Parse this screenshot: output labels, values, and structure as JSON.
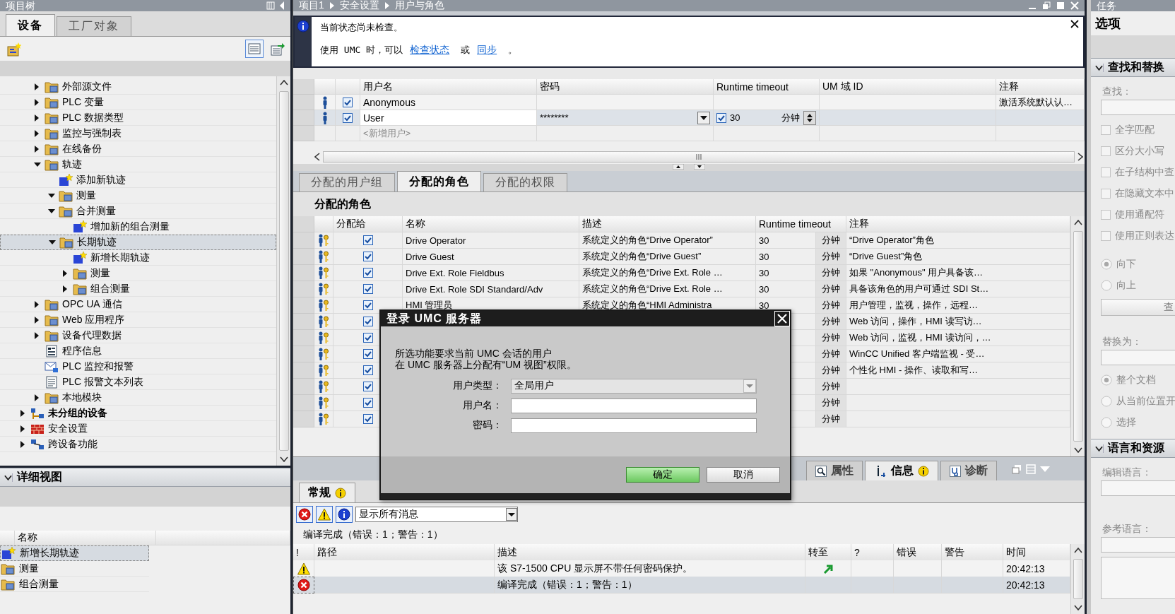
{
  "project_tree": {
    "title": "项目树",
    "tabs": [
      {
        "label": "设备",
        "selected": true
      },
      {
        "label": "工厂对象",
        "selected": false
      }
    ],
    "nested_items": [
      {
        "label": "外部源文件",
        "kind": "folder",
        "expanded": false,
        "selected": false
      },
      {
        "label": "PLC 变量",
        "kind": "folder",
        "expanded": false,
        "selected": false
      },
      {
        "label": "PLC 数据类型",
        "kind": "folder",
        "expanded": false,
        "selected": false
      },
      {
        "label": "监控与强制表",
        "kind": "folder",
        "expanded": false,
        "selected": false
      },
      {
        "label": "在线备份",
        "kind": "folder",
        "expanded": false,
        "selected": false
      },
      {
        "label": "轨迹",
        "kind": "folder",
        "expanded": true,
        "selected": false,
        "children": [
          {
            "label": "添加新轨迹",
            "kind": "add",
            "selected": false
          },
          {
            "label": "测量",
            "kind": "folder",
            "expanded": true,
            "selected": false
          },
          {
            "label": "合并测量",
            "kind": "folder",
            "expanded": true,
            "selected": false,
            "children": [
              {
                "label": "增加新的组合测量",
                "kind": "add",
                "selected": false
              }
            ]
          },
          {
            "label": "长期轨迹",
            "kind": "folder",
            "expanded": true,
            "selected": true,
            "children": [
              {
                "label": "新增长期轨迹",
                "kind": "add",
                "selected": false
              },
              {
                "label": "测量",
                "kind": "folder",
                "expanded": false,
                "selected": false
              },
              {
                "label": "组合测量",
                "kind": "folder",
                "expanded": false,
                "selected": false
              }
            ]
          }
        ]
      },
      {
        "label": "OPC UA 通信",
        "kind": "folder",
        "expanded": false,
        "selected": false
      },
      {
        "label": "Web 应用程序",
        "kind": "folder",
        "expanded": false,
        "selected": false
      },
      {
        "label": "设备代理数据",
        "kind": "folder",
        "expanded": false,
        "selected": false
      },
      {
        "label": "程序信息",
        "kind": "info",
        "selected": false
      },
      {
        "label": "PLC 监控和报警",
        "kind": "alarm",
        "selected": false
      },
      {
        "label": "PLC 报警文本列表",
        "kind": "page",
        "selected": false
      },
      {
        "label": "本地模块",
        "kind": "folder",
        "expanded": false,
        "selected": false
      }
    ],
    "items": [
      {
        "label": "未分组的设备",
        "kind": "devices",
        "expanded": false,
        "selected": false,
        "bold": true
      },
      {
        "label": "安全设置",
        "kind": "security",
        "expanded": false,
        "selected": false
      },
      {
        "label": "跨设备功能",
        "kind": "network",
        "expanded": false,
        "selected": false
      }
    ],
    "detail": {
      "title": "详细视图",
      "columns": [
        "名称"
      ],
      "rows": [
        {
          "label": "新增长期轨迹",
          "kind": "add",
          "selected": true
        },
        {
          "label": "测量",
          "kind": "folder",
          "selected": false
        },
        {
          "label": "组合测量",
          "kind": "folder",
          "selected": false
        }
      ]
    }
  },
  "editor": {
    "breadcrumb": [
      "项目1",
      "安全设置",
      "用户与角色"
    ],
    "banner": {
      "message": "当前状态尚未检查。",
      "prefix": "使用 UMC 时，可以",
      "link_1": "检查状态",
      "middle": "或",
      "link_2": "同步",
      "suffix": "。"
    },
    "users": {
      "columns": [
        "用户名",
        "密码",
        "Runtime timeout",
        "UM 域 ID",
        "注释"
      ],
      "rows": [
        {
          "name": "Anonymous",
          "enabled": true,
          "comment": "激活系统默认认…",
          "selected": false
        },
        {
          "name": "User",
          "enabled": true,
          "password": "********",
          "timeout_enabled": true,
          "timeout": "30",
          "unit": "分钟",
          "selected": true
        }
      ],
      "new_row": "<新增用户>"
    },
    "role_tabs": [
      {
        "label": "分配的用户组",
        "selected": false
      },
      {
        "label": "分配的角色",
        "selected": true
      },
      {
        "label": "分配的权限",
        "selected": false
      }
    ],
    "roles": {
      "title": "分配的角色",
      "columns": [
        "分配给",
        "名称",
        "描述",
        "Runtime timeout",
        "注释"
      ],
      "rows": [
        {
          "assigned": true,
          "name": "Drive Operator",
          "description": "系统定义的角色“Drive Operator”",
          "timeout": "30",
          "unit": "分钟",
          "comment": "“Drive Operator”角色"
        },
        {
          "assigned": true,
          "name": "Drive Guest",
          "description": "系统定义的角色“Drive Guest”",
          "timeout": "30",
          "unit": "分钟",
          "comment": "“Drive Guest”角色"
        },
        {
          "assigned": true,
          "name": "Drive Ext. Role Fieldbus",
          "description": "系统定义的角色“Drive Ext. Role …",
          "timeout": "30",
          "unit": "分钟",
          "comment": "如果 \"Anonymous\" 用户具备该…"
        },
        {
          "assigned": true,
          "name": "Drive Ext. Role SDI Standard/Adv",
          "description": "系统定义的角色“Drive Ext. Role …",
          "timeout": "30",
          "unit": "分钟",
          "comment": "具备该角色的用户可通过 SDI St…"
        },
        {
          "assigned": true,
          "name": "HMI 管理员",
          "description": "系统定义的角色“HMI Administra",
          "timeout": "30",
          "unit": "分钟",
          "comment": "用户管理，监视，操作，远程…"
        },
        {
          "assigned": true,
          "unit": "分钟",
          "comment": "Web 访问，操作，HMI 读写访…"
        },
        {
          "assigned": true,
          "unit": "分钟",
          "comment": "Web 访问，监视，HMI 读访问，…"
        },
        {
          "assigned": true,
          "unit": "分钟",
          "comment": "WinCC Unified 客户端监视 - 受…"
        },
        {
          "assigned": true,
          "unit": "分钟",
          "comment": "个性化 HMI - 操作、读取和写…"
        },
        {
          "assigned": true,
          "unit": "分钟"
        },
        {
          "assigned": true,
          "unit": "分钟"
        },
        {
          "assigned": true,
          "unit": "分钟"
        }
      ]
    },
    "messages": {
      "panel_tabs": [
        {
          "label": "属性",
          "kind": "properties",
          "selected": false
        },
        {
          "label": "信息",
          "kind": "info",
          "selected": true,
          "info_badge": true
        },
        {
          "label": "诊断",
          "kind": "diagnostics",
          "selected": false
        }
      ],
      "tabs": [
        {
          "label": "常规",
          "selected": true,
          "info_badge": true
        }
      ],
      "filters": [
        {
          "kind": "error",
          "on": true
        },
        {
          "kind": "warning",
          "on": true
        },
        {
          "kind": "info",
          "on": true
        }
      ],
      "filter_select": "显示所有消息",
      "summary": "编译完成（错误：1；警告：1）",
      "columns": [
        "!",
        "路径",
        "描述",
        "转至",
        "?",
        "错误",
        "警告",
        "时间"
      ],
      "rows": [
        {
          "kind": "warning",
          "description": "该 S7-1500 CPU 显示屏不带任何密码保护。",
          "goto": true,
          "time": "20:42:13",
          "selected": false
        },
        {
          "kind": "error",
          "description": "编译完成（错误：1；警告：1）",
          "time": "20:42:13",
          "selected": true
        }
      ]
    }
  },
  "tasks": {
    "title": "任务",
    "pane": "选项",
    "find": {
      "title": "查找和替换",
      "expanded": true,
      "find_label": "查找：",
      "options": [
        {
          "label": "全字匹配",
          "checked": false
        },
        {
          "label": "区分大小写",
          "checked": false
        },
        {
          "label": "在子结构中查",
          "checked": false
        },
        {
          "label": "在隐藏文本中",
          "checked": false
        },
        {
          "label": "使用通配符",
          "checked": false
        },
        {
          "label": "使用正则表达",
          "checked": false
        }
      ],
      "directions": [
        {
          "label": "向下",
          "selected": true
        },
        {
          "label": "向上",
          "selected": false
        }
      ],
      "find_button": "查",
      "replace_label": "替换为：",
      "scopes": [
        {
          "label": "整个文档",
          "selected": true
        },
        {
          "label": "从当前位置开",
          "selected": false
        },
        {
          "label": "选择",
          "selected": false
        }
      ]
    },
    "languages": {
      "title": "语言和资源",
      "expanded": true,
      "edit_label": "编辑语言：",
      "reference_label": "参考语言："
    }
  },
  "dialog": {
    "title": "登录 UMC 服务器",
    "message_lines": [
      "所选功能要求当前 UMC 会话的用户",
      "在 UMC 服务器上分配有“UM 视图”权限。"
    ],
    "fields": [
      {
        "kind": "select",
        "label": "用户类型：",
        "value": "全局用户"
      },
      {
        "kind": "text",
        "label": "用户名："
      },
      {
        "kind": "password",
        "label": "密码："
      }
    ],
    "buttons": [
      {
        "label": "确定",
        "default": true
      },
      {
        "label": "取消",
        "default": false
      }
    ]
  }
}
